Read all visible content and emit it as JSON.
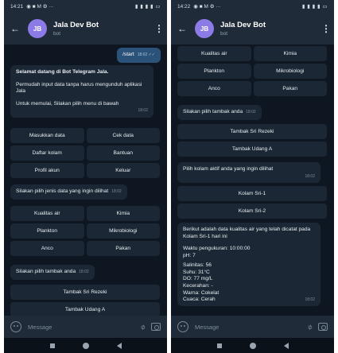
{
  "left": {
    "status": {
      "time": "14:21",
      "left_icons": "◉ ■ M ⚙ ···",
      "right_icons": "▮ ▮ ▮ ▮ ▭"
    },
    "header": {
      "avatar": "JB",
      "title": "Jala Dev Bot",
      "subtitle": "bot"
    },
    "start_msg": {
      "text": "/start",
      "time": "18:02 ✓✓"
    },
    "welcome": {
      "line1": "Selamat datang di Bot Telegram Jala.",
      "line2": "Permudah input data tanpa harus mengunduh aplikasi Jala",
      "line3": "Untuk memulai, Silakan pilih menu di bawah",
      "time": "18:02"
    },
    "main_menu": [
      "Masukkan data",
      "Cek data",
      "Daftar kolam",
      "Bantuan",
      "Profil akun",
      "Keluar"
    ],
    "pilih_jenis": {
      "text": "Silakan pilih jenis data yang ingin dilihat",
      "time": "18:02"
    },
    "jenis_menu": [
      "Kualitas air",
      "Kimia",
      "Plankton",
      "Mikrobiologi",
      "Anco",
      "Pakan"
    ],
    "pilih_tambak": {
      "text": "Silakan pilih tambak anda",
      "time": "18:02"
    },
    "tambak_menu": [
      "Tambak Sri Rezeki",
      "Tambak Udang A"
    ],
    "input": {
      "placeholder": "Message"
    }
  },
  "right": {
    "status": {
      "time": "14:22",
      "left_icons": "◉ ■ M ⚙ ···",
      "right_icons": "▮ ▮ ▮ ▮ ▭"
    },
    "header": {
      "avatar": "JB",
      "title": "Jala Dev Bot",
      "subtitle": "bot"
    },
    "jenis_menu": [
      "Kualitas air",
      "Kimia",
      "Plankton",
      "Mikrobiologi",
      "Anco",
      "Pakan"
    ],
    "pilih_tambak": {
      "text": "Silakan pilih tambak anda",
      "time": "18:02"
    },
    "tambak_menu": [
      "Tambak Sri Rezeki",
      "Tambak Udang A"
    ],
    "pilih_kolam": {
      "text": "Pilih kolam aktif anda yang ingin dilihat",
      "time": "18:02"
    },
    "kolam_menu": [
      "Kolam Sri-1",
      "Kolam Sri-2"
    ],
    "report": {
      "heading": "Berikut adalah data kualitas air yang telah dicatat pada Kolam Sri-1 hari ini",
      "waktu": "Waktu pengukuran: 10:00:00",
      "ph": "pH: 7",
      "salinitas": "Salinitas: 56",
      "suhu": "Suhu: 31°C",
      "do": "DO: 77 mg/L",
      "kecerahan": "Kecerahan: -",
      "warna": "Warna: Cokelat",
      "cuaca": "Cuaca: Cerah",
      "time": "18:02"
    },
    "input": {
      "placeholder": "Message"
    }
  }
}
